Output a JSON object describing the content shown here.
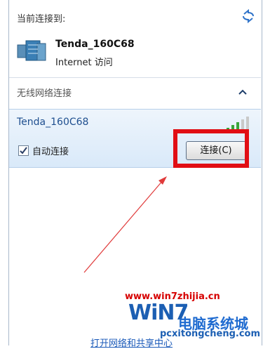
{
  "header": {
    "current_label": "当前连接到:"
  },
  "current_network": {
    "name": "Tenda_160C68",
    "status": "Internet 访问"
  },
  "section": {
    "label": "无线网络连接"
  },
  "network_item": {
    "ssid": "Tenda_160C68",
    "auto_connect_label": "自动连接",
    "auto_connect_checked": true,
    "connect_button": "连接(C)"
  },
  "footer": {
    "link": "打开网络和共享中心"
  },
  "watermark": {
    "url": "www.win7zhijia.cn",
    "logo_text": "WiN7",
    "site_cn": "电脑系统城",
    "site_url": "pcxitongcheng.com"
  },
  "colors": {
    "highlight_box": "#e10e14",
    "arrow": "#e03a3a",
    "link": "#1b5ab9"
  },
  "icons": [
    "refresh-icon",
    "network-computer-icon",
    "collapse-caret-icon",
    "signal-strength-icon",
    "checkbox-check-icon"
  ]
}
